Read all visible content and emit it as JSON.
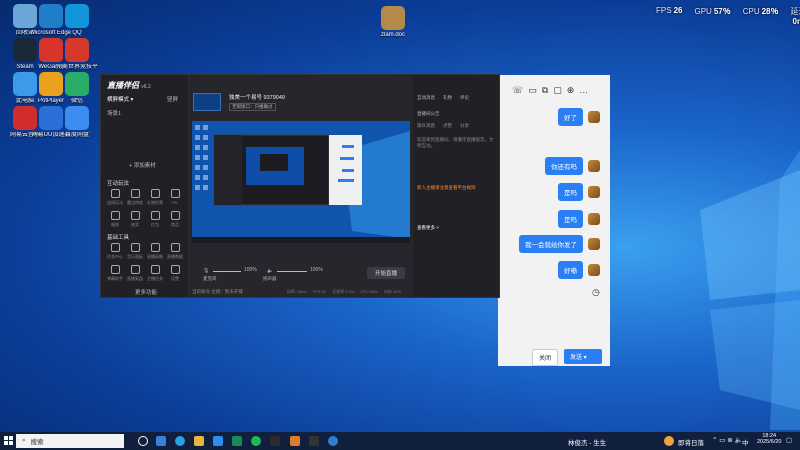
{
  "perf": {
    "fps_label": "FPS",
    "fps": "26",
    "gpu_label": "GPU",
    "gpu": "57％",
    "cpu_label": "CPU",
    "cpu": "28％",
    "latency_label": "延迟",
    "latency": "0ms"
  },
  "desktop_icons": [
    {
      "label": "回收站",
      "color": "#6aa7d8"
    },
    {
      "label": "Microsoft Edge",
      "color": "#1e7ec8"
    },
    {
      "label": "QQ",
      "color": "#1296db"
    },
    {
      "label": "Steam",
      "color": "#1b2838"
    },
    {
      "label": "WeGame",
      "color": "#d9342b"
    },
    {
      "label": "完美世界竞技平台",
      "color": "#d33a2c"
    },
    {
      "label": "此电脑",
      "color": "#3b9be8"
    },
    {
      "label": "PotPlayer",
      "color": "#e9a21d"
    },
    {
      "label": "微信",
      "color": "#2aae67"
    },
    {
      "label": "网易云音乐",
      "color": "#d22d2d"
    },
    {
      "label": "网易UU加速器",
      "color": "#2a6fd6"
    },
    {
      "label": "百度网盘",
      "color": "#3d8df0"
    }
  ],
  "desktop_top_icon": {
    "label": "zlam.doc"
  },
  "app": {
    "brand": "直播伴侣",
    "brand_version": "v8.2",
    "streamer": "独美一个易号 9379049",
    "room_title": "无限接口：只推做过",
    "mode": "横屏模式",
    "mode_right": "竖屏",
    "scene_label": "场景1",
    "add_material": "+ 添加素材",
    "interactive_section": "互动玩法",
    "tools_section": "基础工具",
    "more_features": "更多功能",
    "interactive_tools": [
      "连线玩法",
      "魔法特效",
      "礼物投票",
      "PK",
      "福袋",
      "抽奖",
      "红包",
      "商品"
    ],
    "basic_tools": [
      "任务中心",
      "音乐面板",
      "直播录制",
      "直播数据",
      "弹幕助手",
      "直播复盘",
      "主播任务",
      "设置"
    ],
    "vol_left": "麦克风",
    "vol_left_pct": "100%",
    "vol_right": "扬声器",
    "vol_right_pct": "100%",
    "go_live": "开始直播",
    "status_line": "当前账号 主播：暂未开播",
    "stats": [
      "码率: 0kb/s",
      "FPS 60",
      "丢帧率 0.0%",
      "CPU 28%",
      "内存 42%"
    ],
    "right_tabs": [
      "互动消息",
      "礼物",
      "评论"
    ],
    "sub_tabs": [
      "观众消息",
      "点赞",
      "分享"
    ],
    "notice_title": "直播间公告",
    "notice_body": "欢迎来到直播间，请遵守直播规范，文明互动。",
    "notice_highlight": "新人主播请注意查看平台规则",
    "more_link": "查看更多 >"
  },
  "chat": {
    "messages": [
      "好了",
      "你还有吗",
      "是吗",
      "是吗",
      "我一会就给你发了",
      "好嘞"
    ],
    "close_button": "关闭",
    "send_button": "发送"
  },
  "taskbar": {
    "search_placeholder": "搜索",
    "user": "林俊杰 - 生生",
    "weather": "即将日落",
    "ime": "中",
    "time": "18:24",
    "date": "2025/6/20"
  }
}
